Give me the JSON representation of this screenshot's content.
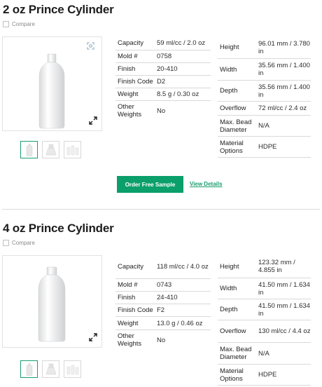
{
  "products": [
    {
      "title": "2 oz Prince Cylinder",
      "compare_label": "Compare",
      "left_specs": [
        {
          "label": "Capacity",
          "value": "59 ml/cc / 2.0 oz"
        },
        {
          "label": "Mold #",
          "value": "0758"
        },
        {
          "label": "Finish",
          "value": "20-410"
        },
        {
          "label": "Finish Code",
          "value": "D2"
        },
        {
          "label": "Weight",
          "value": "8.5 g / 0.30 oz"
        },
        {
          "label": "Other Weights",
          "value": "No"
        }
      ],
      "right_specs": [
        {
          "label": "Height",
          "value": "96.01 mm / 3.780 in"
        },
        {
          "label": "Width",
          "value": "35.56 mm / 1.400 in"
        },
        {
          "label": "Depth",
          "value": "35.56 mm / 1.400 in"
        },
        {
          "label": "Overflow",
          "value": "72 ml/cc / 2.4 oz"
        },
        {
          "label": "Max. Bead Diameter",
          "value": "N/A"
        },
        {
          "label": "Material Options",
          "value": "HDPE"
        }
      ],
      "order_button": "Order Free Sample",
      "view_details": "View Details"
    },
    {
      "title": "4 oz Prince Cylinder",
      "compare_label": "Compare",
      "left_specs": [
        {
          "label": "Capacity",
          "value": "118 ml/cc / 4.0 oz"
        },
        {
          "label": "Mold #",
          "value": "0743"
        },
        {
          "label": "Finish",
          "value": "24-410"
        },
        {
          "label": "Finish Code",
          "value": "F2"
        },
        {
          "label": "Weight",
          "value": "13.0 g / 0.46 oz"
        },
        {
          "label": "Other Weights",
          "value": "No"
        }
      ],
      "right_specs": [
        {
          "label": "Height",
          "value": "123.32 mm / 4.855 in"
        },
        {
          "label": "Width",
          "value": "41.50 mm / 1.634 in"
        },
        {
          "label": "Depth",
          "value": "41.50 mm / 1.634 in"
        },
        {
          "label": "Overflow",
          "value": "130 ml/cc / 4.4 oz"
        },
        {
          "label": "Max. Bead Diameter",
          "value": "N/A"
        },
        {
          "label": "Material Options",
          "value": "HDPE"
        }
      ]
    }
  ],
  "icons": {
    "zoom": "zoom-icon",
    "expand": "expand-icon",
    "thumb_1": "bottle-front-thumbnail",
    "thumb_2": "bottle-cap-thumbnail",
    "thumb_3": "bottle-variants-thumbnail"
  },
  "colors": {
    "accent": "#0a9f6b",
    "divider": "#d9d9d9"
  }
}
